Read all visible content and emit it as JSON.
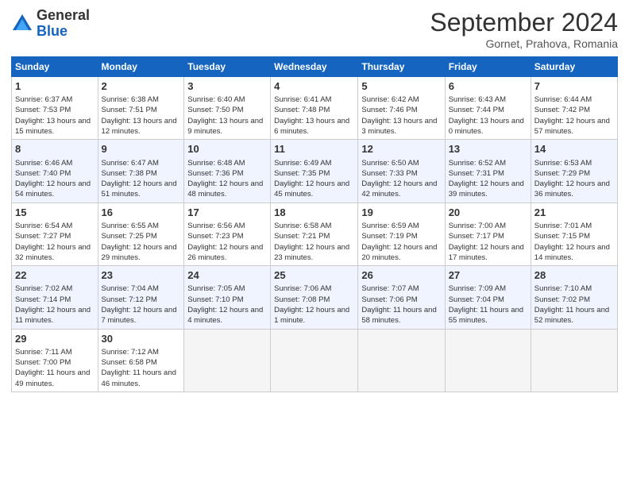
{
  "header": {
    "logo_general": "General",
    "logo_blue": "Blue",
    "title": "September 2024",
    "subtitle": "Gornet, Prahova, Romania"
  },
  "days_of_week": [
    "Sunday",
    "Monday",
    "Tuesday",
    "Wednesday",
    "Thursday",
    "Friday",
    "Saturday"
  ],
  "weeks": [
    [
      {
        "day": 1,
        "info": "Sunrise: 6:37 AM\nSunset: 7:53 PM\nDaylight: 13 hours and 15 minutes."
      },
      {
        "day": 2,
        "info": "Sunrise: 6:38 AM\nSunset: 7:51 PM\nDaylight: 13 hours and 12 minutes."
      },
      {
        "day": 3,
        "info": "Sunrise: 6:40 AM\nSunset: 7:50 PM\nDaylight: 13 hours and 9 minutes."
      },
      {
        "day": 4,
        "info": "Sunrise: 6:41 AM\nSunset: 7:48 PM\nDaylight: 13 hours and 6 minutes."
      },
      {
        "day": 5,
        "info": "Sunrise: 6:42 AM\nSunset: 7:46 PM\nDaylight: 13 hours and 3 minutes."
      },
      {
        "day": 6,
        "info": "Sunrise: 6:43 AM\nSunset: 7:44 PM\nDaylight: 13 hours and 0 minutes."
      },
      {
        "day": 7,
        "info": "Sunrise: 6:44 AM\nSunset: 7:42 PM\nDaylight: 12 hours and 57 minutes."
      }
    ],
    [
      {
        "day": 8,
        "info": "Sunrise: 6:46 AM\nSunset: 7:40 PM\nDaylight: 12 hours and 54 minutes."
      },
      {
        "day": 9,
        "info": "Sunrise: 6:47 AM\nSunset: 7:38 PM\nDaylight: 12 hours and 51 minutes."
      },
      {
        "day": 10,
        "info": "Sunrise: 6:48 AM\nSunset: 7:36 PM\nDaylight: 12 hours and 48 minutes."
      },
      {
        "day": 11,
        "info": "Sunrise: 6:49 AM\nSunset: 7:35 PM\nDaylight: 12 hours and 45 minutes."
      },
      {
        "day": 12,
        "info": "Sunrise: 6:50 AM\nSunset: 7:33 PM\nDaylight: 12 hours and 42 minutes."
      },
      {
        "day": 13,
        "info": "Sunrise: 6:52 AM\nSunset: 7:31 PM\nDaylight: 12 hours and 39 minutes."
      },
      {
        "day": 14,
        "info": "Sunrise: 6:53 AM\nSunset: 7:29 PM\nDaylight: 12 hours and 36 minutes."
      }
    ],
    [
      {
        "day": 15,
        "info": "Sunrise: 6:54 AM\nSunset: 7:27 PM\nDaylight: 12 hours and 32 minutes."
      },
      {
        "day": 16,
        "info": "Sunrise: 6:55 AM\nSunset: 7:25 PM\nDaylight: 12 hours and 29 minutes."
      },
      {
        "day": 17,
        "info": "Sunrise: 6:56 AM\nSunset: 7:23 PM\nDaylight: 12 hours and 26 minutes."
      },
      {
        "day": 18,
        "info": "Sunrise: 6:58 AM\nSunset: 7:21 PM\nDaylight: 12 hours and 23 minutes."
      },
      {
        "day": 19,
        "info": "Sunrise: 6:59 AM\nSunset: 7:19 PM\nDaylight: 12 hours and 20 minutes."
      },
      {
        "day": 20,
        "info": "Sunrise: 7:00 AM\nSunset: 7:17 PM\nDaylight: 12 hours and 17 minutes."
      },
      {
        "day": 21,
        "info": "Sunrise: 7:01 AM\nSunset: 7:15 PM\nDaylight: 12 hours and 14 minutes."
      }
    ],
    [
      {
        "day": 22,
        "info": "Sunrise: 7:02 AM\nSunset: 7:14 PM\nDaylight: 12 hours and 11 minutes."
      },
      {
        "day": 23,
        "info": "Sunrise: 7:04 AM\nSunset: 7:12 PM\nDaylight: 12 hours and 7 minutes."
      },
      {
        "day": 24,
        "info": "Sunrise: 7:05 AM\nSunset: 7:10 PM\nDaylight: 12 hours and 4 minutes."
      },
      {
        "day": 25,
        "info": "Sunrise: 7:06 AM\nSunset: 7:08 PM\nDaylight: 12 hours and 1 minute."
      },
      {
        "day": 26,
        "info": "Sunrise: 7:07 AM\nSunset: 7:06 PM\nDaylight: 11 hours and 58 minutes."
      },
      {
        "day": 27,
        "info": "Sunrise: 7:09 AM\nSunset: 7:04 PM\nDaylight: 11 hours and 55 minutes."
      },
      {
        "day": 28,
        "info": "Sunrise: 7:10 AM\nSunset: 7:02 PM\nDaylight: 11 hours and 52 minutes."
      }
    ],
    [
      {
        "day": 29,
        "info": "Sunrise: 7:11 AM\nSunset: 7:00 PM\nDaylight: 11 hours and 49 minutes."
      },
      {
        "day": 30,
        "info": "Sunrise: 7:12 AM\nSunset: 6:58 PM\nDaylight: 11 hours and 46 minutes."
      },
      null,
      null,
      null,
      null,
      null
    ]
  ]
}
